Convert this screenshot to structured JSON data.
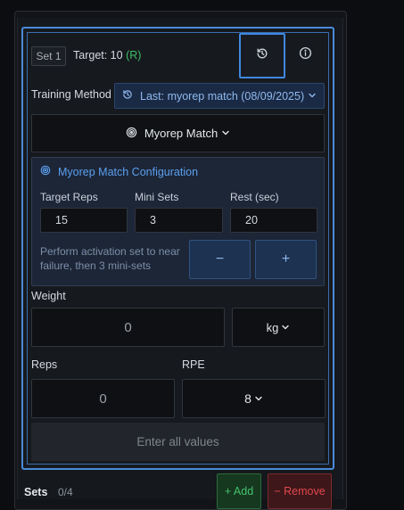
{
  "set": {
    "badge": "Set 1",
    "target_label": "Target: 10",
    "target_marker": "(R)"
  },
  "icons": {
    "history": "history-icon",
    "info": "info-icon",
    "target": "target-icon",
    "chevron": "chevron-down-icon"
  },
  "training_method": {
    "label": "Training Method",
    "selected": "Last: myorep match (08/09/2025)"
  },
  "method_select": {
    "value": "Myorep Match"
  },
  "config": {
    "title": "Myorep Match Configuration",
    "fields": [
      {
        "label": "Target Reps",
        "value": "15"
      },
      {
        "label": "Mini Sets",
        "value": "3"
      },
      {
        "label": "Rest (sec)",
        "value": "20"
      }
    ],
    "description": "Perform activation set to near failure, then 3 mini-sets",
    "minus": "−",
    "plus": "+"
  },
  "weight": {
    "label": "Weight",
    "value": "0",
    "unit": "kg"
  },
  "reps": {
    "label": "Reps",
    "value": "0"
  },
  "rpe": {
    "label": "RPE",
    "value": "8"
  },
  "submit": {
    "label": "Enter all values"
  },
  "footer": {
    "sets_label": "Sets",
    "sets_count": "0/4",
    "add_label": "+ Add",
    "remove_label": "− Remove"
  },
  "colors": {
    "accent": "#4a8bd8",
    "success": "#3fbf6a",
    "danger": "#e0484e",
    "config_title": "#5c9ff0"
  }
}
